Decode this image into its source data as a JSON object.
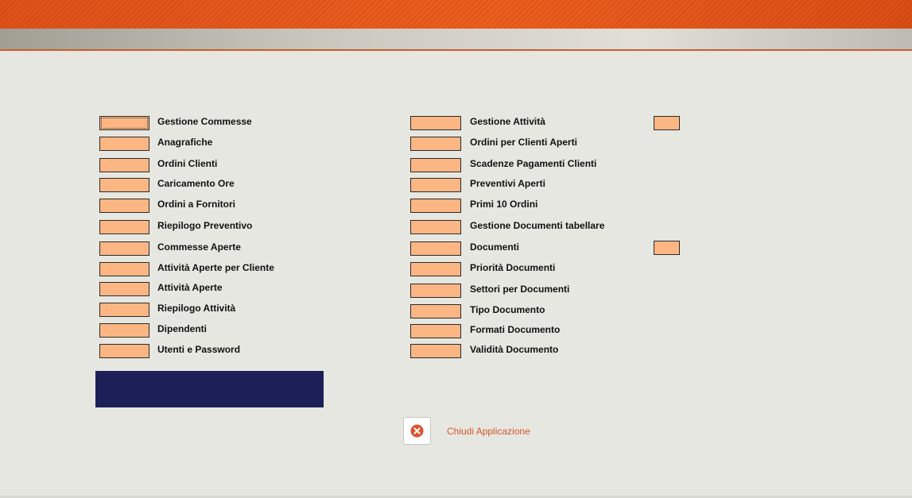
{
  "menu": {
    "left_items": [
      "Gestione Commesse",
      "Anagrafiche",
      "Ordini Clienti",
      "Caricamento Ore",
      "Ordini a Fornitori",
      "Riepilogo Preventivo",
      "Commesse Aperte",
      "Attività Aperte per Cliente",
      "Attività Aperte",
      "Riepilogo Attività",
      "Dipendenti",
      "Utenti e Password"
    ],
    "right_items": [
      "Gestione Attività",
      "Ordini per Clienti Aperti",
      "Scadenze Pagamenti Clienti",
      "Preventivi Aperti",
      "Primi 10 Ordini",
      "Gestione Documenti tabellare",
      "Documenti",
      "Priorità Documenti",
      "Settori per Documenti",
      "Tipo Documento",
      "Formati Documento",
      "Validità Documento"
    ]
  },
  "footer": {
    "close_label": "Chiudi Applicazione",
    "close_icon": "close-circle-icon"
  },
  "colors": {
    "header": "#e9591e",
    "button_fill": "#fbb684",
    "panel": "#1c2057",
    "link": "#d2562a",
    "background": "#e7e7e1"
  }
}
